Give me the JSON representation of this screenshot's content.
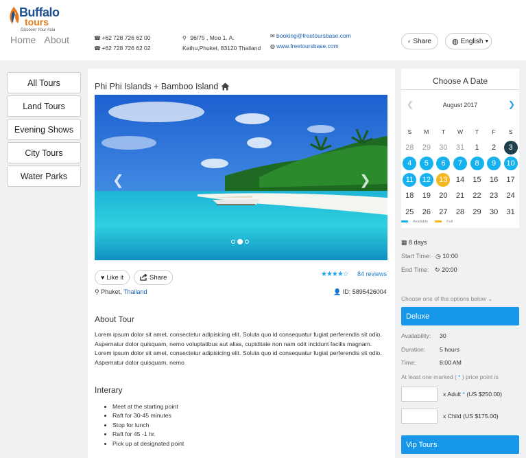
{
  "brand": {
    "line1": "Buffalo",
    "line2": "tours",
    "tagline": "Discover Your Asia"
  },
  "nav": {
    "home": "Home",
    "about": "About"
  },
  "contact": {
    "phone1": "+62 728 726 62 00",
    "phone2": "+62 728 726 62 02",
    "addr1": "96/75 , Moo 1. A.",
    "addr2": "Kathu,Phuket, 83120 Thailand",
    "email": "booking@freetoursbase.com",
    "web": "www.freetoursbase.com"
  },
  "header_buttons": {
    "share": "Share",
    "language": "English"
  },
  "sidebar": {
    "items": [
      "All Tours",
      "Land Tours",
      "Evening Shows",
      "City Tours",
      "Water Parks"
    ]
  },
  "tour": {
    "title": "Phi Phi Islands + Bamboo Island",
    "like": "Like it",
    "share": "Share",
    "stars": "★★★★☆",
    "reviews": "84 reviews",
    "location_city": "Phuket,",
    "location_country": "Thailand",
    "id_label": "ID: 5895426004",
    "carousel": {
      "dots": 3,
      "active": 1
    }
  },
  "about": {
    "heading": "About Tour",
    "text": "Lorem ipsum dolor sit amet, consectetur adipisicing elit. Soluta quo id consequatur fugiat perferendis sit odio. Aspernatur dolor quisquam, nemo voluptatibus aut alias, cupiditate non nam odit incidunt facilis magnam. Lorem ipsum dolor sit amet, consectetur adipisicing elit. Soluta quo id consequatur fugiat perferendis sit odio. Aspernatur dolor quisquam, nemo"
  },
  "itinerary": {
    "heading": "Interary",
    "items": [
      "Meet at the starting point",
      "Raft for 30-45 minutes",
      "Stop for lunch",
      "Raft for 45 -1 hr.",
      "Pick up at designated point"
    ]
  },
  "calendar": {
    "heading": "Choose A Date",
    "month": "August 2017",
    "weekdays": [
      "S",
      "M",
      "T",
      "W",
      "T",
      "F",
      "S"
    ],
    "weeks": [
      [
        {
          "d": "28",
          "s": "muted"
        },
        {
          "d": "29",
          "s": "muted"
        },
        {
          "d": "30",
          "s": "muted"
        },
        {
          "d": "31",
          "s": "muted"
        },
        {
          "d": "1",
          "s": ""
        },
        {
          "d": "2",
          "s": ""
        },
        {
          "d": "3",
          "s": "today"
        }
      ],
      [
        {
          "d": "4",
          "s": "avail"
        },
        {
          "d": "5",
          "s": "avail"
        },
        {
          "d": "6",
          "s": "avail"
        },
        {
          "d": "7",
          "s": "avail"
        },
        {
          "d": "8",
          "s": "avail"
        },
        {
          "d": "9",
          "s": "avail"
        },
        {
          "d": "10",
          "s": "avail"
        }
      ],
      [
        {
          "d": "11",
          "s": "avail"
        },
        {
          "d": "12",
          "s": "avail"
        },
        {
          "d": "13",
          "s": "full"
        },
        {
          "d": "14",
          "s": ""
        },
        {
          "d": "15",
          "s": ""
        },
        {
          "d": "16",
          "s": ""
        },
        {
          "d": "17",
          "s": ""
        }
      ],
      [
        {
          "d": "18",
          "s": ""
        },
        {
          "d": "19",
          "s": ""
        },
        {
          "d": "20",
          "s": ""
        },
        {
          "d": "21",
          "s": ""
        },
        {
          "d": "22",
          "s": ""
        },
        {
          "d": "23",
          "s": ""
        },
        {
          "d": "24",
          "s": ""
        }
      ],
      [
        {
          "d": "25",
          "s": ""
        },
        {
          "d": "26",
          "s": ""
        },
        {
          "d": "27",
          "s": ""
        },
        {
          "d": "28",
          "s": ""
        },
        {
          "d": "29",
          "s": ""
        },
        {
          "d": "30",
          "s": ""
        },
        {
          "d": "31",
          "s": ""
        }
      ]
    ],
    "legend_available": "Available",
    "legend_full": "Full",
    "colors": {
      "available": "#16b1ef",
      "full": "#f6b820",
      "today": "#1f3f4c"
    }
  },
  "info": {
    "duration": "8 days",
    "start_label": "Start Time:",
    "start_value": "10:00",
    "end_label": "End Time:",
    "end_value": "20:00",
    "options_hint": "Choose one of the options below"
  },
  "option": {
    "name": "Deluxe",
    "availability_label": "Availability:",
    "availability": "30",
    "duration_label": "Duration:",
    "duration": "5 hours",
    "time_label": "Time:",
    "time": "8:00 AM",
    "price_note_pre": "At least one marked (",
    "price_note_star": " * ",
    "price_note_post": ") price point is",
    "adult_label": "x Adult",
    "adult_star": "*",
    "adult_price": "(US $250.00)",
    "child_label": "x Child (US $175.00)",
    "next_option": "Vip Tours"
  }
}
